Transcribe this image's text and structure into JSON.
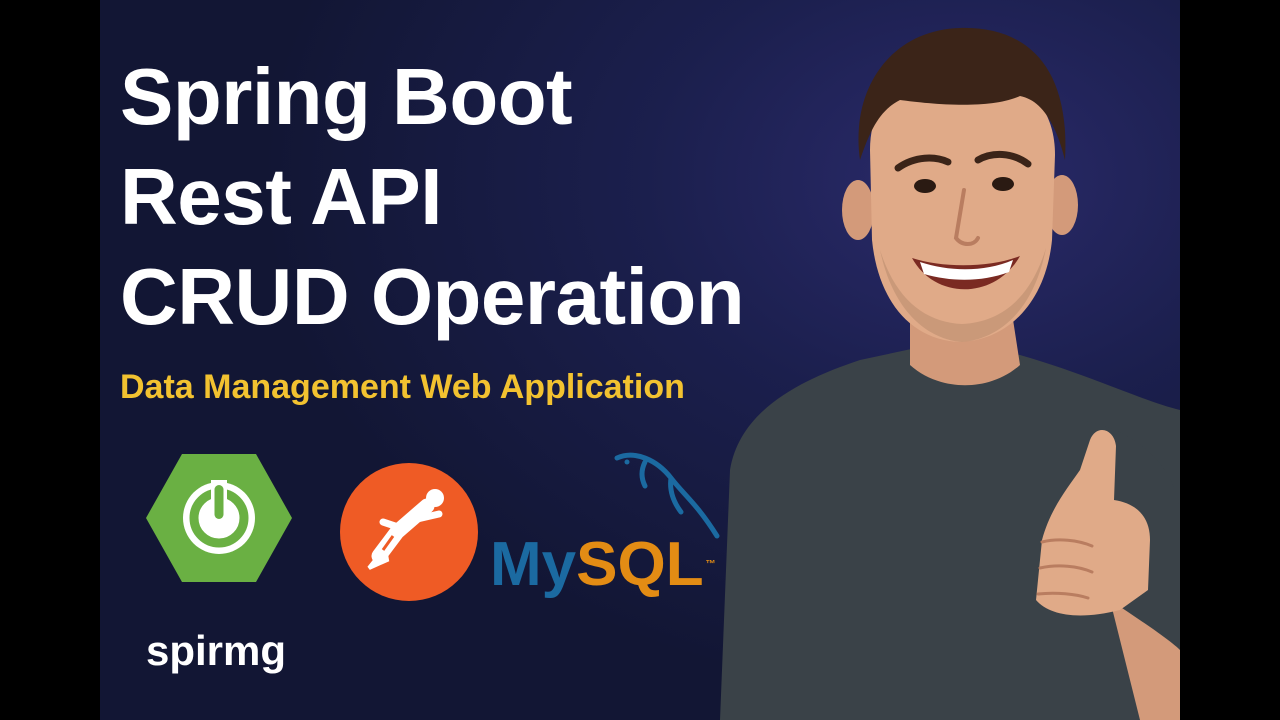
{
  "thumbnail": {
    "title_lines": [
      "Spring Boot",
      "Rest API",
      "CRUD Operation"
    ],
    "subtitle": "Data Management Web Application"
  },
  "logos": {
    "spring_wordmark": "spirmg",
    "mysql_part1": "My",
    "mysql_part2": "SQL",
    "mysql_trademark": "™"
  },
  "icons": {
    "spring": "power-icon",
    "postman": "astronaut-icon",
    "mysql": "dolphin-icon"
  },
  "colors": {
    "background": "#1b1f4d",
    "title": "#ffffff",
    "subtitle": "#f2c230",
    "spring_green": "#6ab043",
    "postman_orange": "#ef5b25",
    "mysql_blue": "#1b6aa1",
    "mysql_orange": "#e38c14"
  }
}
